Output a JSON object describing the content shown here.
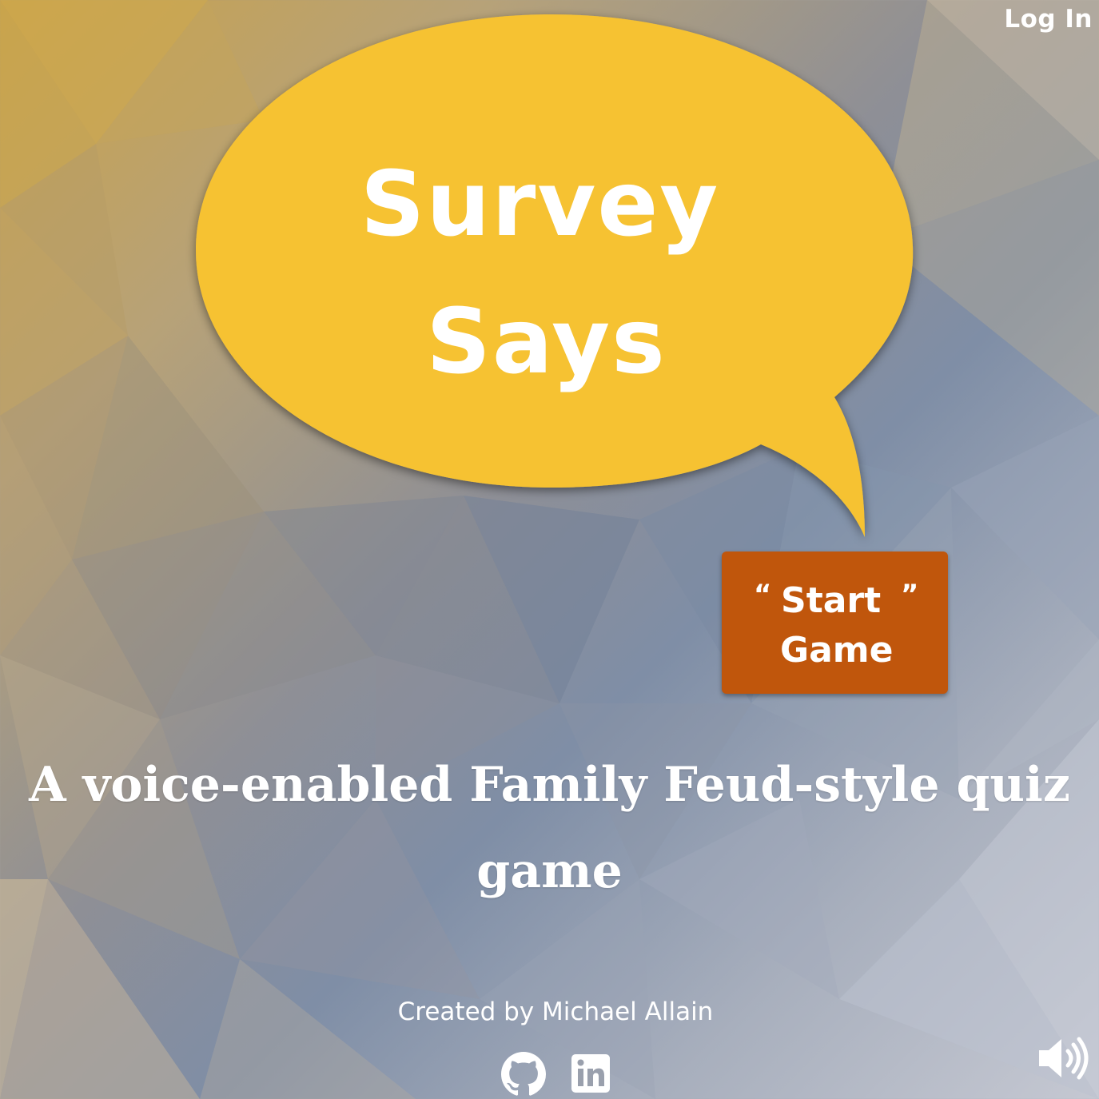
{
  "header": {
    "login_label": "Log In"
  },
  "hero": {
    "title_line1": "Survey",
    "title_line2": "Says"
  },
  "start_button": {
    "quote_open": "“",
    "quote_close": "”",
    "line1": "Start",
    "line2": "Game"
  },
  "tagline": "A voice-enabled Family Feud-style quiz game",
  "footer": {
    "credit": "Created by Michael Allain",
    "social": [
      {
        "icon": "github-icon"
      },
      {
        "icon": "linkedin-icon"
      }
    ],
    "sound_icon": "speaker-icon"
  },
  "colors": {
    "bubble": "#f6c232",
    "start_button": "#c0560c",
    "text": "#ffffff"
  }
}
